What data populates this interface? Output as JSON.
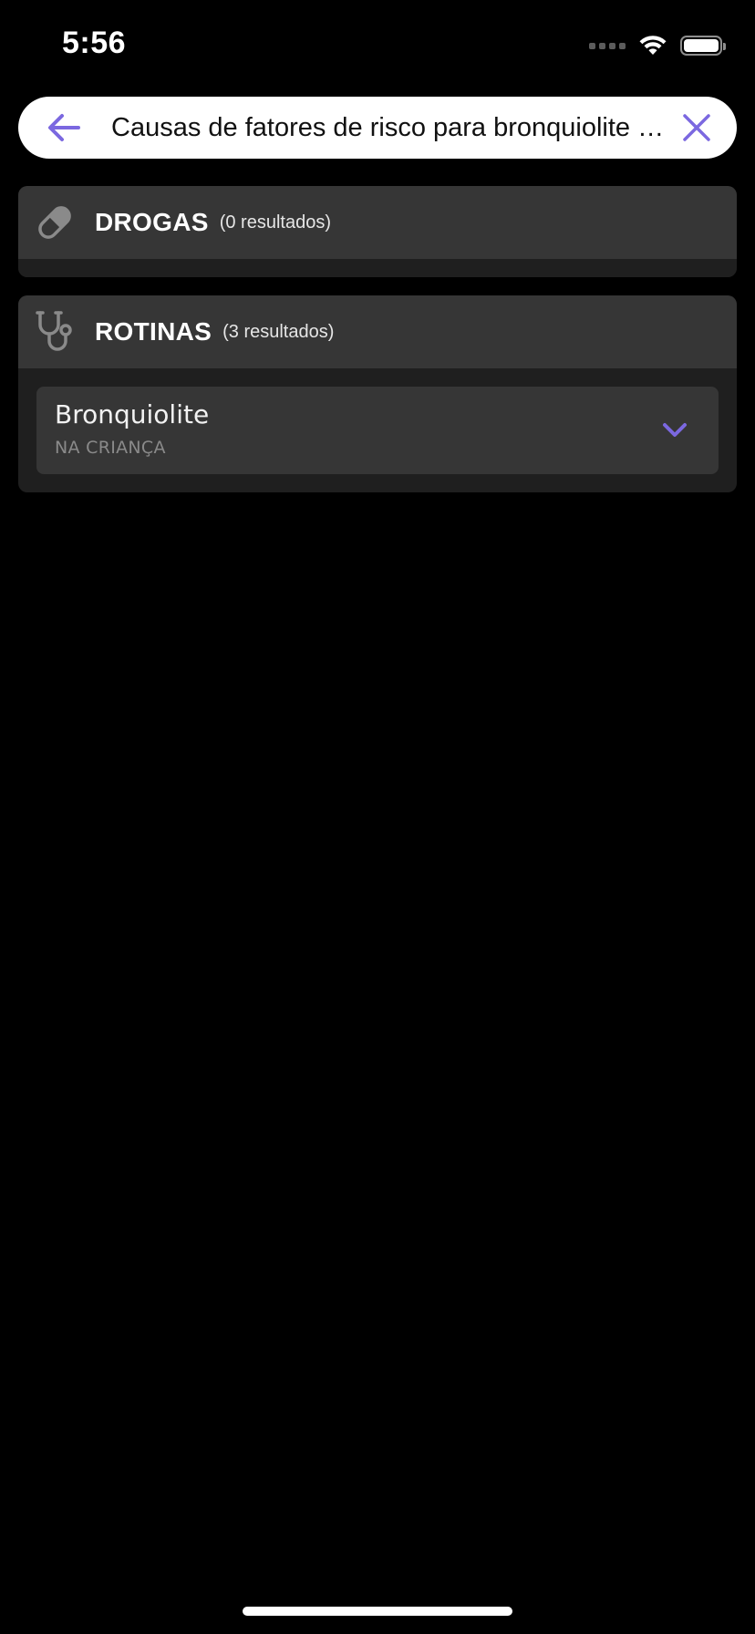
{
  "status_bar": {
    "time": "5:56",
    "icons": [
      "signal-dots-icon",
      "wifi-icon",
      "battery-icon"
    ]
  },
  "search": {
    "query": "Causas de fatores de risco para bronquiolite vir…",
    "back_icon": "arrow-left-icon",
    "clear_icon": "close-icon"
  },
  "colors": {
    "accent": "#7b68e0",
    "background": "#000000",
    "header_bg": "#363636",
    "section_bg": "#1f1f1f"
  },
  "sections": [
    {
      "title": "DROGAS",
      "count": "(0 resultados)",
      "icon": "pill-icon",
      "items": []
    },
    {
      "title": "ROTINAS",
      "count": "(3 resultados)",
      "icon": "stethoscope-icon",
      "items": [
        {
          "title": "Bronquiolite",
          "subtitle": "NA CRIANÇA",
          "icon": "chevron-down-icon"
        }
      ]
    }
  ]
}
